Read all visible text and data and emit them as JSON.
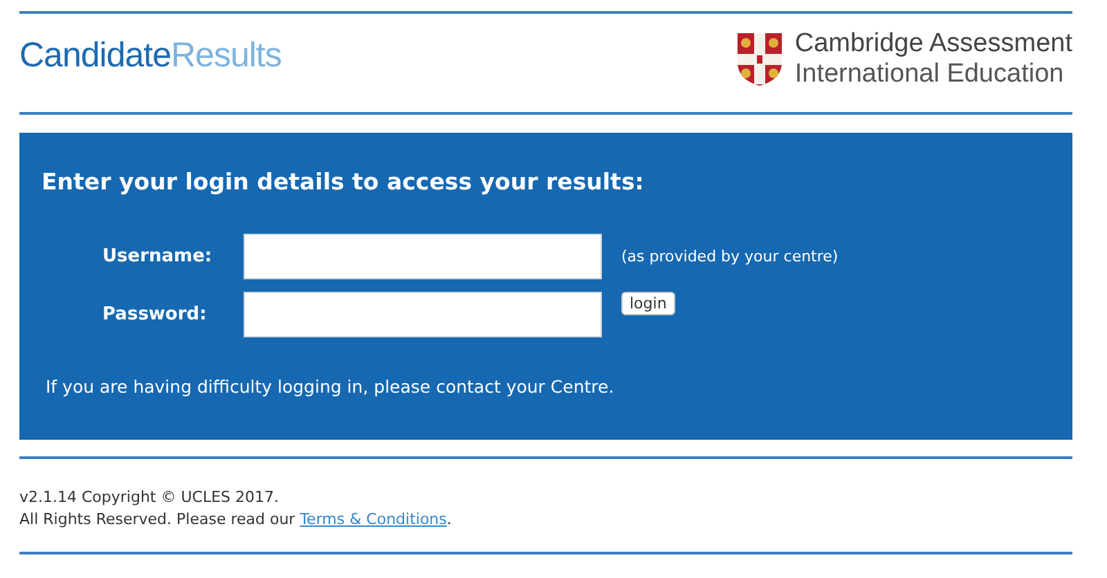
{
  "header": {
    "logo": {
      "primary": "Candidate",
      "secondary": "Results"
    },
    "org": {
      "line_1": "Cambridge Assessment",
      "line_2": "International Education"
    }
  },
  "login_panel": {
    "heading": "Enter your login details to access your results:",
    "fields": [
      {
        "label": "Username:",
        "hint": "(as provided by your centre)"
      },
      {
        "label": "Password:"
      }
    ],
    "button": "login",
    "help": "If you are having difficulty logging in, please contact your Centre."
  },
  "footer": {
    "version": "v2.1.14 Copyright © UCLES 2017.",
    "rights_before": "All Rights Reserved. Please read our ",
    "link": "Terms & Conditions",
    "rights_after": "."
  }
}
